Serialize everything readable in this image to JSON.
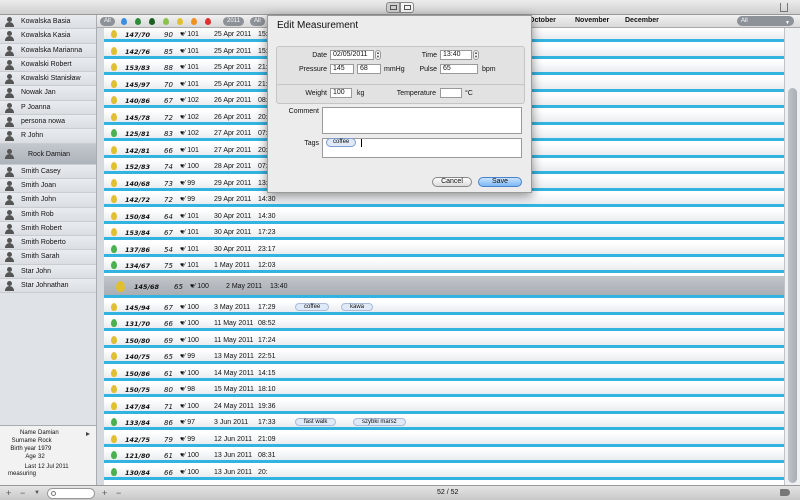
{
  "sidebar": {
    "people": [
      "Kowalska Basia",
      "Kowalska Kasia",
      "Kowalska Marianna",
      "Kowalski Robert",
      "Kowalski Stanisław",
      "Nowak Jan",
      "P Joanna",
      "persona nowa",
      "R John",
      "Rock Damian",
      "Smith Casey",
      "Smith Joan",
      "Smith John",
      "Smith Rob",
      "Smith Robert",
      "Smith Roberto",
      "Smith Sarah",
      "Star John",
      "Star Johnathan"
    ],
    "selected_index": 9,
    "info": {
      "name_label": "Name",
      "name_value": "Damian",
      "surname_label": "Surname",
      "surname_value": "Rock",
      "birth_label": "Birth year",
      "birth_value": "1979",
      "age_label": "Age",
      "age_value": "32",
      "last_label": "Last",
      "last_value": "12 Jul 2011",
      "measuring_label": "measuring"
    }
  },
  "filterbar": {
    "all_left": "All",
    "year": "2011",
    "all_right": "All",
    "months": [
      "October",
      "November",
      "December"
    ],
    "month_select": "All",
    "drop_colors": [
      "#3b8fe0",
      "#2e8b3a",
      "#1b5e20",
      "#8bc34a",
      "#e0c030",
      "#f09020",
      "#e03030"
    ]
  },
  "rows": [
    {
      "bp": "147/70",
      "pulse": "90",
      "heart": "♥⁄ 101",
      "date": "25 Apr 2011",
      "time": "15:",
      "color": "#e0c030"
    },
    {
      "bp": "142/76",
      "pulse": "85",
      "heart": "♥⁄ 101",
      "date": "25 Apr 2011",
      "time": "15:",
      "color": "#e0c030"
    },
    {
      "bp": "153/83",
      "pulse": "88",
      "heart": "♥⁄ 101",
      "date": "25 Apr 2011",
      "time": "21:",
      "color": "#e0c030"
    },
    {
      "bp": "145/97",
      "pulse": "70",
      "heart": "♥⁄ 101",
      "date": "25 Apr 2011",
      "time": "21:",
      "color": "#e0c030"
    },
    {
      "bp": "140/86",
      "pulse": "67",
      "heart": "♥⁄ 102",
      "date": "26 Apr 2011",
      "time": "08:",
      "color": "#e0c030"
    },
    {
      "bp": "145/78",
      "pulse": "72",
      "heart": "♥⁄ 102",
      "date": "26 Apr 2011",
      "time": "20:",
      "color": "#e0c030"
    },
    {
      "bp": "125/81",
      "pulse": "83",
      "heart": "♥⁄ 102",
      "date": "27 Apr 2011",
      "time": "07:",
      "color": "#4caf50"
    },
    {
      "bp": "142/81",
      "pulse": "66",
      "heart": "♥⁄ 101",
      "date": "27 Apr 2011",
      "time": "20:",
      "color": "#e0c030"
    },
    {
      "bp": "152/83",
      "pulse": "74",
      "heart": "♥⁄ 100",
      "date": "28 Apr 2011",
      "time": "07:",
      "color": "#e0c030"
    },
    {
      "bp": "140/68",
      "pulse": "73",
      "heart": "♥⁄ 99",
      "date": "29 Apr 2011",
      "time": "13:",
      "color": "#e0c030"
    },
    {
      "bp": "142/72",
      "pulse": "72",
      "heart": "♥⁄ 99",
      "date": "29 Apr 2011",
      "time": "14:30",
      "color": "#e0c030"
    },
    {
      "bp": "150/84",
      "pulse": "64",
      "heart": "♥⁄ 101",
      "date": "30 Apr 2011",
      "time": "14:30",
      "color": "#e0c030"
    },
    {
      "bp": "153/84",
      "pulse": "67",
      "heart": "♥⁄ 101",
      "date": "30 Apr 2011",
      "time": "17:23",
      "color": "#e0c030"
    },
    {
      "bp": "137/86",
      "pulse": "54",
      "heart": "♥⁄ 101",
      "date": "30 Apr 2011",
      "time": "23:17",
      "color": "#4caf50"
    },
    {
      "bp": "134/67",
      "pulse": "75",
      "heart": "♥⁄ 101",
      "date": "1 May 2011",
      "time": "12:03",
      "color": "#4caf50"
    },
    {
      "bp": "145/68",
      "pulse": "65",
      "heart": "♥⁄ 100",
      "date": "2 May 2011",
      "time": "13:40",
      "color": "#e0c030",
      "big": true
    },
    {
      "bp": "145/94",
      "pulse": "67",
      "heart": "♥⁄ 100",
      "date": "3 May 2011",
      "time": "17:29",
      "color": "#e0c030",
      "tags": [
        "coffee",
        "kawa"
      ]
    },
    {
      "bp": "131/70",
      "pulse": "66",
      "heart": "♥⁄ 100",
      "date": "11 May 2011",
      "time": "08:52",
      "color": "#4caf50"
    },
    {
      "bp": "150/80",
      "pulse": "69",
      "heart": "♥⁄ 100",
      "date": "11 May 2011",
      "time": "17:24",
      "color": "#e0c030"
    },
    {
      "bp": "140/75",
      "pulse": "65",
      "heart": "♥⁄ 99",
      "date": "13 May 2011",
      "time": "22:51",
      "color": "#e0c030"
    },
    {
      "bp": "150/86",
      "pulse": "61",
      "heart": "♥⁄ 100",
      "date": "14 May 2011",
      "time": "14:15",
      "color": "#e0c030"
    },
    {
      "bp": "150/75",
      "pulse": "80",
      "heart": "♥⁄ 98",
      "date": "15 May 2011",
      "time": "18:10",
      "color": "#e0c030"
    },
    {
      "bp": "147/84",
      "pulse": "71",
      "heart": "♥⁄ 100",
      "date": "24 May 2011",
      "time": "19:36",
      "color": "#e0c030"
    },
    {
      "bp": "133/84",
      "pulse": "86",
      "heart": "♥⁄ 97",
      "date": "3 Jun 2011",
      "time": "17:33",
      "color": "#4caf50",
      "tags": [
        "fast walk",
        "szybki marsz"
      ]
    },
    {
      "bp": "142/75",
      "pulse": "79",
      "heart": "♥⁄ 99",
      "date": "12 Jun 2011",
      "time": "21:09",
      "color": "#e0c030"
    },
    {
      "bp": "121/80",
      "pulse": "61",
      "heart": "♥⁄ 100",
      "date": "13 Jun 2011",
      "time": "08:31",
      "color": "#4caf50"
    },
    {
      "bp": "130/84",
      "pulse": "66",
      "heart": "♥⁄ 100",
      "date": "13 Jun 2011",
      "time": "20:",
      "color": "#4caf50"
    }
  ],
  "dialog": {
    "title": "Edit Measurement",
    "date_label": "Date",
    "date_value": "02/05/2011",
    "time_label": "Time",
    "time_value": "13:40",
    "pressure_label": "Pressure",
    "systolic": "145",
    "diastolic": "68",
    "pressure_unit": "mmHg",
    "pulse_label": "Pulse",
    "pulse_value": "65",
    "pulse_unit": "bpm",
    "weight_label": "Weight",
    "weight_value": "100",
    "weight_unit": "kg",
    "temperature_label": "Temperature",
    "temperature_value": "",
    "temperature_unit": "°C",
    "comment_label": "Comment",
    "comment_value": "",
    "tags_label": "Tags",
    "tag": "coffee",
    "cancel_label": "Cancel",
    "save_label": "Save"
  },
  "bottombar": {
    "count": "52 / 52",
    "plus": "+",
    "minus": "−"
  }
}
